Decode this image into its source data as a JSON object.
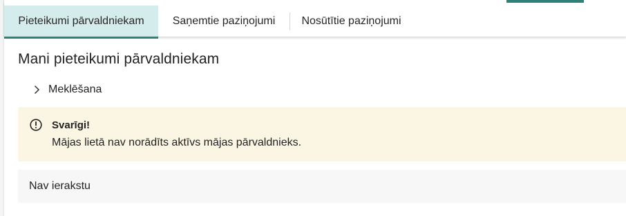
{
  "tabs": [
    {
      "label": "Pieteikumi pārvaldniekam",
      "active": true
    },
    {
      "label": "Saņemtie paziņojumi",
      "active": false
    },
    {
      "label": "Nosūtītie paziņojumi",
      "active": false
    }
  ],
  "page": {
    "title": "Mani pieteikumi pārvaldniekam"
  },
  "search": {
    "label": "Meklēšana",
    "icon": "chevron-right-icon"
  },
  "alert": {
    "icon": "exclamation-circle-icon",
    "title": "Svarīgi!",
    "message": "Mājas lietā nav norādīts aktīvs mājas pārvaldnieks."
  },
  "results": {
    "empty_text": "Nav ierakstu"
  },
  "colors": {
    "accent": "#2f8079",
    "active_tab_bg": "#d4eceb",
    "alert_bg": "#faf6e3",
    "empty_row_bg": "#f7f7f7"
  }
}
